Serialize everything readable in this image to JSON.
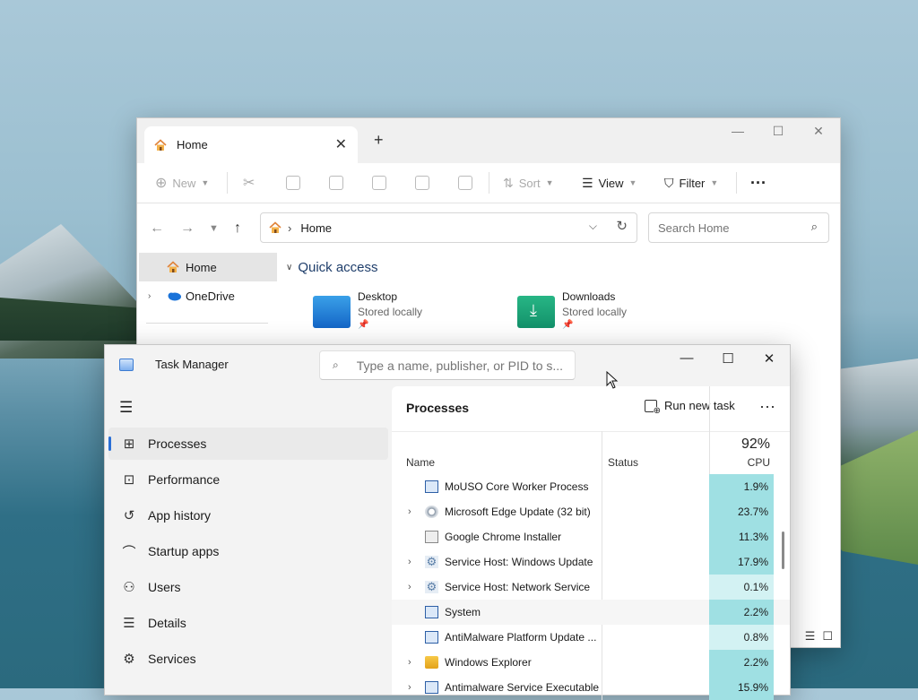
{
  "explorer": {
    "tab_title": "Home",
    "toolbar": {
      "new_label": "New",
      "sort_label": "Sort",
      "view_label": "View",
      "filter_label": "Filter"
    },
    "address": {
      "crumb": "Home"
    },
    "search_placeholder": "Search Home",
    "nav": [
      {
        "label": "Home"
      },
      {
        "label": "OneDrive"
      }
    ],
    "quick_access": {
      "title": "Quick access",
      "items": [
        {
          "name": "Desktop",
          "sub": "Stored locally"
        },
        {
          "name": "Downloads",
          "sub": "Stored locally"
        }
      ]
    }
  },
  "taskmanager": {
    "title": "Task Manager",
    "search_placeholder": "Type a name, publisher, or PID to s...",
    "nav": [
      {
        "label": "Processes",
        "icon": "processes-icon"
      },
      {
        "label": "Performance",
        "icon": "performance-icon"
      },
      {
        "label": "App history",
        "icon": "app-history-icon"
      },
      {
        "label": "Startup apps",
        "icon": "startup-apps-icon"
      },
      {
        "label": "Users",
        "icon": "users-icon"
      },
      {
        "label": "Details",
        "icon": "details-icon"
      },
      {
        "label": "Services",
        "icon": "services-icon"
      }
    ],
    "main_title": "Processes",
    "run_task": "Run new task",
    "columns": {
      "name": "Name",
      "status": "Status",
      "cpu_total": "92%",
      "cpu": "CPU"
    },
    "processes": [
      {
        "name": "MoUSO Core Worker Process",
        "cpu": "1.9%"
      },
      {
        "name": "Microsoft Edge Update (32 bit)",
        "cpu": "23.7%"
      },
      {
        "name": "Google Chrome Installer",
        "cpu": "11.3%"
      },
      {
        "name": "Service Host: Windows Update",
        "cpu": "17.9%"
      },
      {
        "name": "Service Host: Network Service",
        "cpu": "0.1%"
      },
      {
        "name": "System",
        "cpu": "2.2%"
      },
      {
        "name": "AntiMalware Platform Update ...",
        "cpu": "0.8%"
      },
      {
        "name": "Windows Explorer",
        "cpu": "2.2%"
      },
      {
        "name": "Antimalware Service Executable",
        "cpu": "15.9%"
      }
    ]
  },
  "colors": {
    "accent": "#2a6fd6",
    "cpu_high": "#9fe0e3",
    "cpu_low": "#d3f2f3"
  }
}
